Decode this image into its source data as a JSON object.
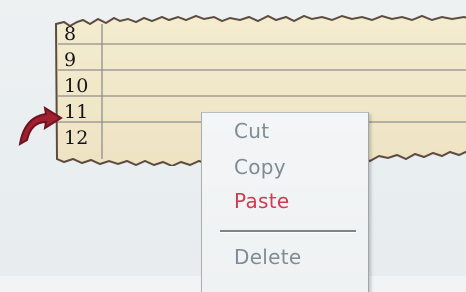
{
  "sheet": {
    "rows": [
      {
        "label": "8"
      },
      {
        "label": "9"
      },
      {
        "label": "10"
      },
      {
        "label": "11"
      },
      {
        "label": "12"
      }
    ]
  },
  "context_menu": {
    "items": [
      {
        "label": "Cut",
        "state": "disabled"
      },
      {
        "label": "Copy",
        "state": "disabled"
      },
      {
        "label": "Paste",
        "state": "enabled"
      },
      {
        "label": "Delete",
        "state": "disabled"
      }
    ],
    "colors": {
      "enabled_text": "#d23b51",
      "disabled_text": "#7f8c96"
    }
  },
  "pointer": {
    "icon": "curved-arrow-icon",
    "color": "#a1202f"
  },
  "colors": {
    "sheet_background": "#efe6c8",
    "gridline": "#8f8f8f"
  }
}
